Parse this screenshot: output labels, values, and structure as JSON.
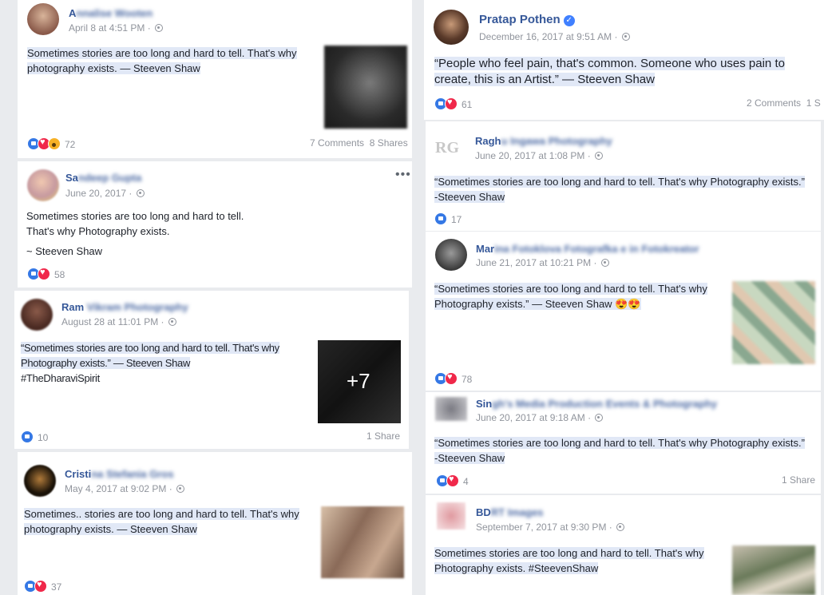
{
  "posts": [
    {
      "name_prefix": "A",
      "name_blur": "nnalise Wooten",
      "time": "April 8 at 4:51 PM",
      "text": "Sometimes stories are too long and hard to tell. That's why photography exists. — Steeven Shaw",
      "reactions": "72",
      "comments": "7 Comments",
      "shares": "8 Shares"
    },
    {
      "name_prefix": "Sa",
      "name_blur": "ndeep Gupta",
      "time": "June 20, 2017",
      "line1": "Sometimes stories are too long and hard to tell.",
      "line2": "That's why Photography exists.",
      "line3": "~ Steeven Shaw",
      "reactions": "58",
      "more": "•••"
    },
    {
      "name_prefix": "Ram",
      "name_blur": " Vikram Photography",
      "time": "August 28 at 11:01 PM",
      "text": "“Sometimes stories are too long and hard to tell. That's why Photography exists.” — Steeven Shaw",
      "tag": "#TheDharaviSpirit",
      "reactions": "10",
      "shares": "1 Share",
      "photo_more": "+7"
    },
    {
      "name_prefix": "Cristi",
      "name_blur": "na Stefania Gros",
      "time": "May 4, 2017 at 9:02 PM",
      "text": "Sometimes.. stories are too long and hard to tell. That's why photography exists. — Steeven Shaw",
      "reactions": "37"
    },
    {
      "name": "Pratap Pothen",
      "verified": "✓",
      "time": "December 16, 2017 at 9:51 AM",
      "text": "“People who feel pain, that's common. Someone who uses pain to create, this is an Artist.” — Steeven Shaw",
      "reactions": "61",
      "comments": "2 Comments",
      "shares": "1 S"
    },
    {
      "name_prefix": "Ragh",
      "name_blur": "u Ingawa Photography",
      "avatar_text": "RG",
      "time": "June 20, 2017 at 1:08 PM",
      "text": "“Sometimes stories are too long and hard to tell. That's why Photography exists.” -Steeven Shaw",
      "reactions": "17"
    },
    {
      "name_prefix": "Mar",
      "name_blur": "ina Fotoklova Fotografka e in Fotokreator",
      "time": "June 21, 2017 at 10:21 PM",
      "text": "“Sometimes stories are too long and hard to tell. That's why Photography exists.” — Steeven Shaw 😍😍",
      "reactions": "78"
    },
    {
      "name_prefix": "Sin",
      "name_blur": "gh's Media Production Events & Photography",
      "time": "June 20, 2017 at 9:18 AM",
      "text": "“Sometimes stories are too long and hard to tell. That's why Photography exists.” -Steeven Shaw",
      "reactions": "4",
      "shares": "1 Share"
    },
    {
      "name_prefix": "BD",
      "name_blur": "RT Images",
      "time": "September 7, 2017 at 9:30 PM",
      "text": "Sometimes stories are too long and hard to tell. That's why Photography exists. #SteevenShaw"
    }
  ],
  "colors": {
    "link": "#365899",
    "meta": "#90949c",
    "highlight": "#e1e8f6",
    "like": "#3578e5",
    "love": "#f0284a",
    "page_bg": "#e9ebee"
  }
}
